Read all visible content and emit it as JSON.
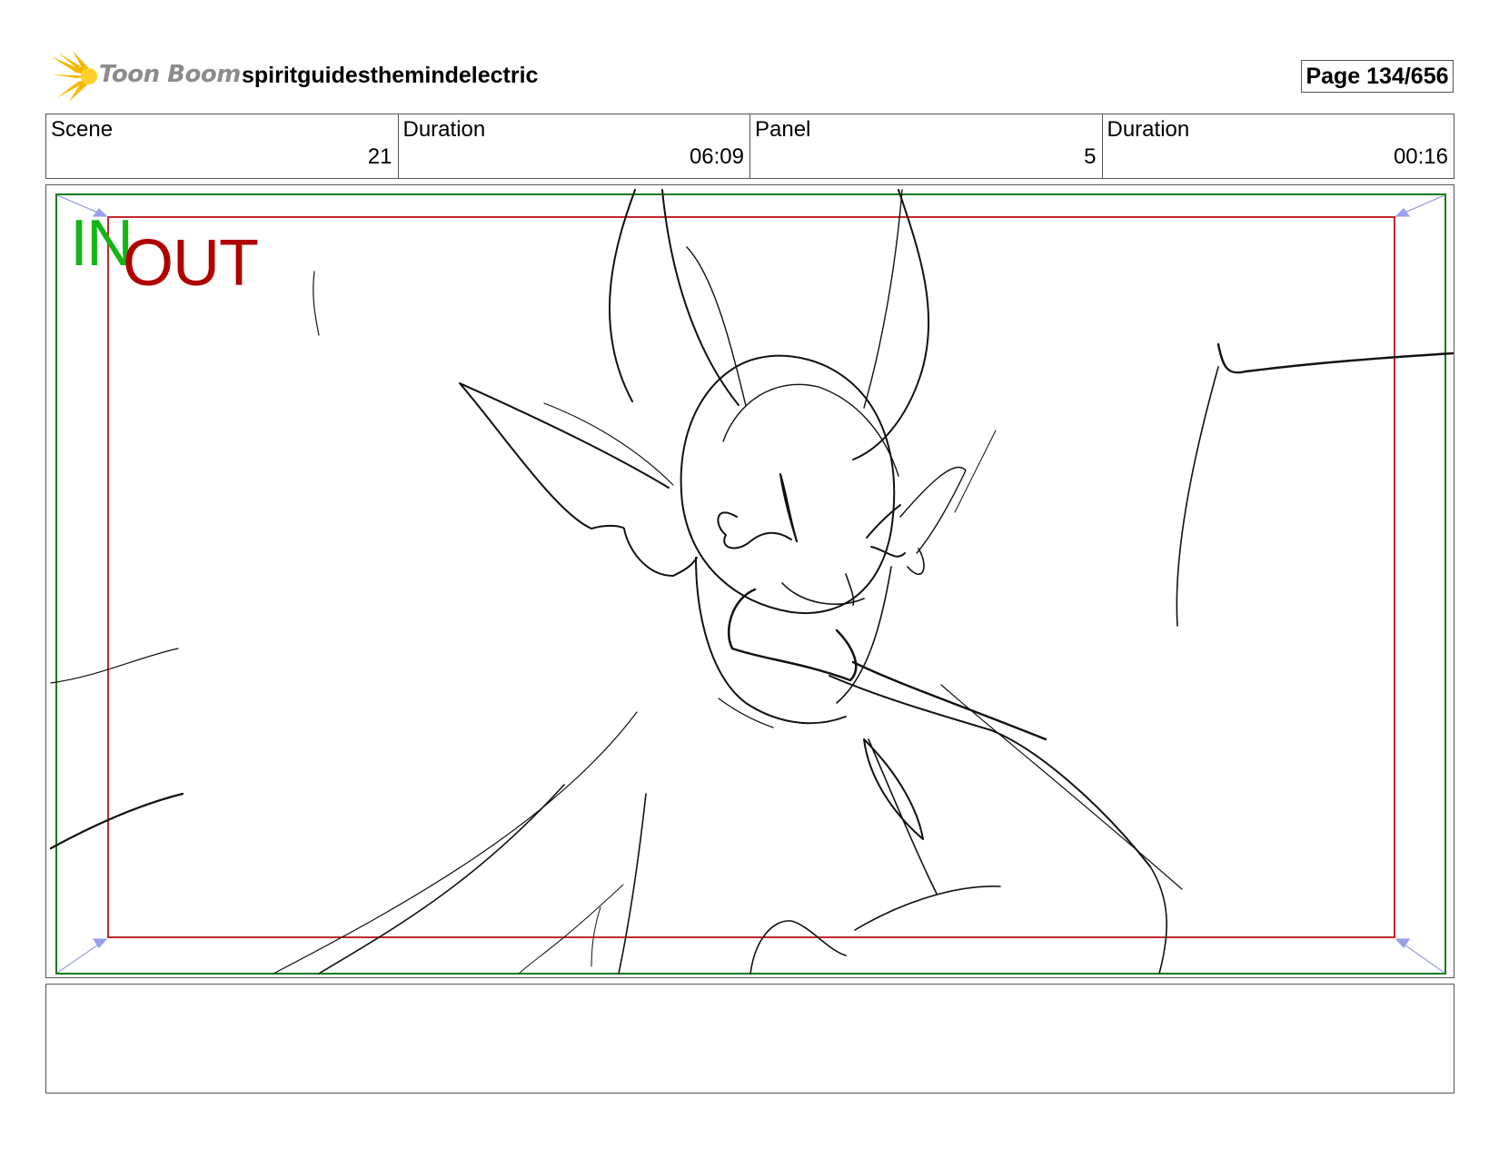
{
  "header": {
    "logo_text": "Toon Boom",
    "project_title": "spiritguidesthemindelectric",
    "page_label": "Page 134/656"
  },
  "info": {
    "scene_label": "Scene",
    "scene_value": "21",
    "scene_duration_label": "Duration",
    "scene_duration_value": "06:09",
    "panel_label": "Panel",
    "panel_value": "5",
    "panel_duration_label": "Duration",
    "panel_duration_value": "00:16"
  },
  "panel": {
    "in_label": "IN",
    "out_label": "OUT",
    "in_frame_color": "#1a7a1a",
    "out_frame_color": "#c0272d",
    "guide_arrow_color": "#9aa0e8"
  },
  "notes": {
    "text": ""
  },
  "colors": {
    "logo_star": "#f5b800",
    "logo_text": "#8c8c8c"
  }
}
